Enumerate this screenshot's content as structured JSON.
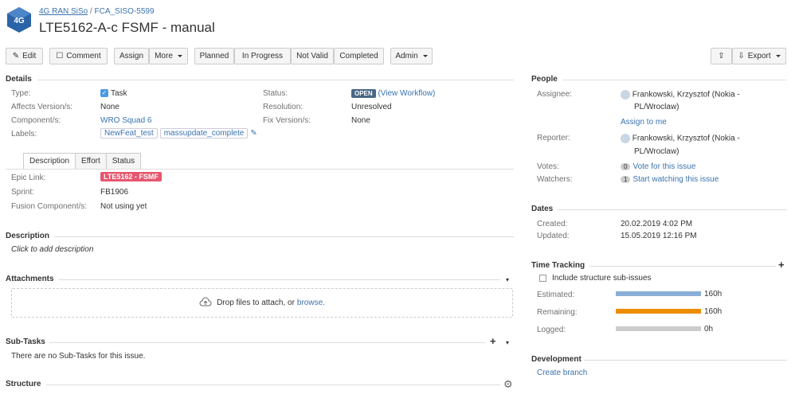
{
  "header": {
    "project_link": "4G RAN SiSo",
    "separator": "/",
    "issue_key": "FCA_SISO-5599",
    "title": "LTE5162-A-c FSMF - manual",
    "logo_text": "4G",
    "logo_subtext": "RAN SiSo"
  },
  "toolbar": {
    "edit": "Edit",
    "comment": "Comment",
    "assign": "Assign",
    "more": "More",
    "planned": "Planned",
    "in_progress": "In Progress",
    "not_valid": "Not Valid",
    "completed": "Completed",
    "admin": "Admin",
    "export": "Export"
  },
  "details": {
    "heading": "Details",
    "type_label": "Type:",
    "type_value": "Task",
    "affects_label": "Affects Version/s:",
    "affects_value": "None",
    "components_label": "Component/s:",
    "components_value": "WRO Squad 6",
    "labels_label": "Labels:",
    "labels": [
      "NewFeat_test",
      "massupdate_complete"
    ],
    "status_label": "Status:",
    "status_value": "OPEN",
    "view_workflow": "(View Workflow)",
    "resolution_label": "Resolution:",
    "resolution_value": "Unresolved",
    "fix_label": "Fix Version/s:",
    "fix_value": "None"
  },
  "tabs": [
    "Description",
    "Effort",
    "Status"
  ],
  "tab_fields": {
    "epic_label": "Epic Link:",
    "epic_value": "LTE5162 - FSMF",
    "sprint_label": "Sprint:",
    "sprint_value": "FB1906",
    "fusion_label": "Fusion Component/s:",
    "fusion_value": "Not using yet"
  },
  "description": {
    "heading": "Description",
    "placeholder": "Click to add description"
  },
  "attachments": {
    "heading": "Attachments",
    "drop_text": "Drop files to attach, or",
    "browse": "browse."
  },
  "subtasks": {
    "heading": "Sub-Tasks",
    "empty": "There are no Sub-Tasks for this issue."
  },
  "structure": {
    "heading": "Structure"
  },
  "people": {
    "heading": "People",
    "assignee_label": "Assignee:",
    "assignee_line1": "Frankowski, Krzysztof (Nokia -",
    "assignee_line2": "PL/Wroclaw)",
    "assign_to_me": "Assign to me",
    "reporter_label": "Reporter:",
    "reporter_line1": "Frankowski, Krzysztof (Nokia -",
    "reporter_line2": "PL/Wroclaw)",
    "votes_label": "Votes:",
    "votes_count": "0",
    "votes_link": "Vote for this issue",
    "watchers_label": "Watchers:",
    "watchers_count": "1",
    "watchers_link": "Start watching this issue"
  },
  "dates": {
    "heading": "Dates",
    "created_label": "Created:",
    "created_value": "20.02.2019 4:02 PM",
    "updated_label": "Updated:",
    "updated_value": "15.05.2019 12:16 PM"
  },
  "time_tracking": {
    "heading": "Time Tracking",
    "include_label": "Include structure sub-issues",
    "estimated_label": "Estimated:",
    "estimated_value": "160h",
    "estimated_fraction": 1.0,
    "remaining_label": "Remaining:",
    "remaining_value": "160h",
    "remaining_fraction": 1.0,
    "logged_label": "Logged:",
    "logged_value": "0h",
    "logged_fraction": 0.0,
    "colors": {
      "estimated": "#89afd7",
      "remaining": "#ec8e00",
      "logged": "#cccccc"
    }
  },
  "development": {
    "heading": "Development",
    "create_branch": "Create branch"
  }
}
